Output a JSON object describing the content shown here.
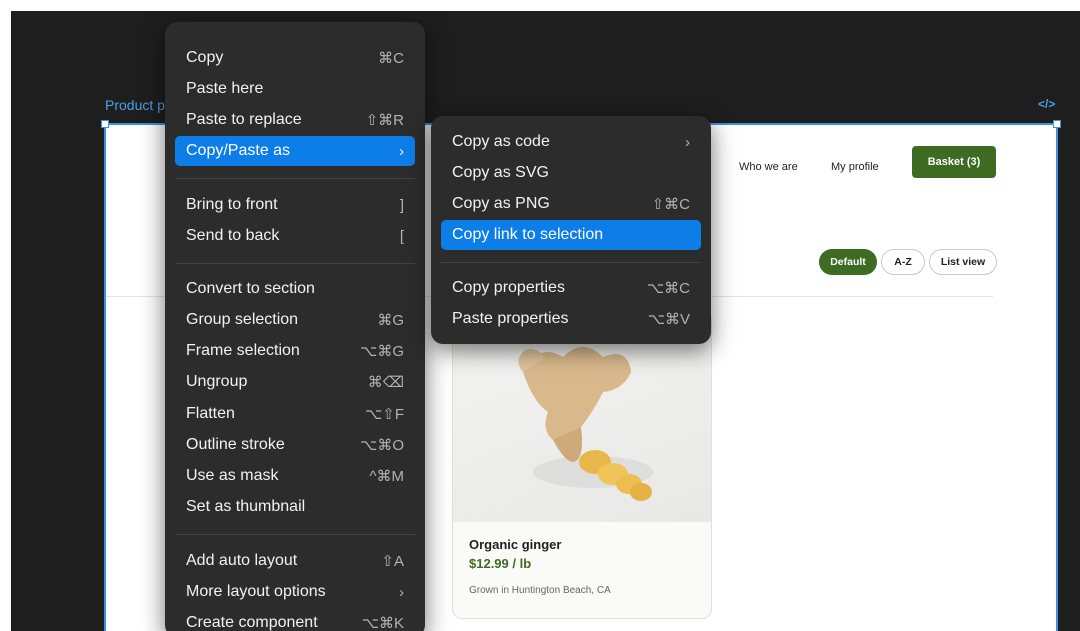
{
  "frame": {
    "label": "Product p",
    "code_icon": "</>"
  },
  "site": {
    "nav": [
      "Who we are",
      "My profile"
    ],
    "basket": "Basket (3)",
    "filters": [
      "Default",
      "A-Z",
      "List view"
    ],
    "product": {
      "name": "Organic ginger",
      "price": "$12.99 / lb",
      "origin": "Grown in Huntington Beach, CA"
    }
  },
  "context_menu": {
    "items": [
      {
        "label": "Copy",
        "shortcut": "⌘C"
      },
      {
        "label": "Paste here",
        "shortcut": ""
      },
      {
        "label": "Paste to replace",
        "shortcut": "⇧⌘R"
      },
      {
        "label": "Copy/Paste as",
        "shortcut": "›"
      },
      {
        "label": "Bring to front",
        "shortcut": "]"
      },
      {
        "label": "Send to back",
        "shortcut": "["
      },
      {
        "label": "Convert to section",
        "shortcut": ""
      },
      {
        "label": "Group selection",
        "shortcut": "⌘G"
      },
      {
        "label": "Frame selection",
        "shortcut": "⌥⌘G"
      },
      {
        "label": "Ungroup",
        "shortcut": "⌘⌫"
      },
      {
        "label": "Flatten",
        "shortcut": "⌥⇧F"
      },
      {
        "label": "Outline stroke",
        "shortcut": "⌥⌘O"
      },
      {
        "label": "Use as mask",
        "shortcut": "^⌘M"
      },
      {
        "label": "Set as thumbnail",
        "shortcut": ""
      },
      {
        "label": "Add auto layout",
        "shortcut": "⇧A"
      },
      {
        "label": "More layout options",
        "shortcut": "›"
      },
      {
        "label": "Create component",
        "shortcut": "⌥⌘K"
      }
    ]
  },
  "submenu": {
    "items": [
      {
        "label": "Copy as code",
        "shortcut": "›"
      },
      {
        "label": "Copy as SVG",
        "shortcut": ""
      },
      {
        "label": "Copy as PNG",
        "shortcut": "⇧⌘C"
      },
      {
        "label": "Copy link to selection",
        "shortcut": ""
      },
      {
        "label": "Copy properties",
        "shortcut": "⌥⌘C"
      },
      {
        "label": "Paste properties",
        "shortcut": "⌥⌘V"
      }
    ]
  },
  "colors": {
    "accent": "#0d7ee8",
    "brand_green": "#3d6b22",
    "selection_blue": "#3d8fe0"
  }
}
